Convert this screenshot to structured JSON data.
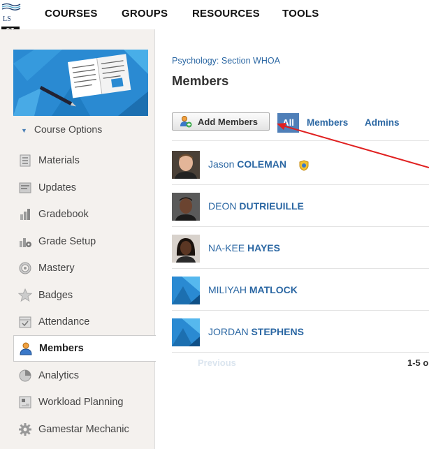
{
  "logo": {
    "text": "LS",
    "badge": "ST"
  },
  "topnav": {
    "items": [
      "COURSES",
      "GROUPS",
      "RESOURCES",
      "TOOLS"
    ]
  },
  "sidebar": {
    "course_options": "Course Options",
    "items": [
      {
        "label": "Materials",
        "icon": "materials-icon"
      },
      {
        "label": "Updates",
        "icon": "updates-icon"
      },
      {
        "label": "Gradebook",
        "icon": "gradebook-icon"
      },
      {
        "label": "Grade Setup",
        "icon": "grade-setup-icon"
      },
      {
        "label": "Mastery",
        "icon": "mastery-icon"
      },
      {
        "label": "Badges",
        "icon": "badges-icon"
      },
      {
        "label": "Attendance",
        "icon": "attendance-icon"
      },
      {
        "label": "Members",
        "icon": "members-icon",
        "active": true
      },
      {
        "label": "Analytics",
        "icon": "analytics-icon"
      },
      {
        "label": "Workload Planning",
        "icon": "workload-planning-icon"
      },
      {
        "label": "Gamestar Mechanic",
        "icon": "gamestar-mechanic-icon"
      }
    ]
  },
  "main": {
    "breadcrumb": "Psychology: Section WHOA",
    "title": "Members",
    "add_members_label": "Add Members",
    "filters": {
      "all": "All",
      "members": "Members",
      "admins": "Admins"
    },
    "members": [
      {
        "first": "Jason",
        "last": "COLEMAN",
        "admin": true,
        "avatar": "photo"
      },
      {
        "first": "DEON",
        "last": "DUTRIEUILLE",
        "admin": false,
        "avatar": "photo"
      },
      {
        "first": "NA-KEE",
        "last": "HAYES",
        "admin": false,
        "avatar": "photo"
      },
      {
        "first": "MILIYAH",
        "last": "MATLOCK",
        "admin": false,
        "avatar": "default"
      },
      {
        "first": "JORDAN",
        "last": "STEPHENS",
        "admin": false,
        "avatar": "default"
      }
    ],
    "pagination": {
      "previous": "Previous",
      "count": "1-5 o"
    }
  },
  "colors": {
    "link": "#2b67a3",
    "accent": "#4f7fb8",
    "annotation": "#e02020"
  }
}
